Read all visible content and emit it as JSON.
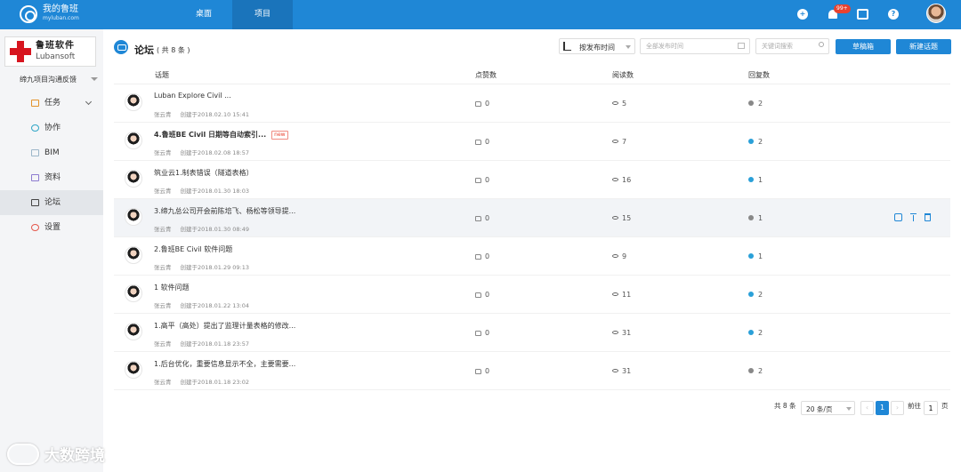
{
  "topbar": {
    "app_title": "我的鲁班",
    "app_sub": "myluban.com",
    "tabs": [
      {
        "label": "桌面"
      },
      {
        "label": "项目"
      }
    ],
    "badge": "99+",
    "icons": [
      "plus-icon",
      "bell-icon",
      "calendar-icon",
      "help-icon",
      "avatar"
    ],
    "accent": "#1f87d6"
  },
  "sidebar": {
    "brand_cn": "鲁班软件",
    "brand_en": "Lubansoft",
    "project": "缔九项目沟通反馈",
    "items": [
      {
        "label": "任务",
        "icon": "task-icon"
      },
      {
        "label": "协作",
        "icon": "collab-icon"
      },
      {
        "label": "BIM",
        "icon": "bim-icon"
      },
      {
        "label": "资料",
        "icon": "data-icon"
      },
      {
        "label": "论坛",
        "icon": "forum-icon"
      },
      {
        "label": "设置",
        "icon": "settings-icon"
      }
    ]
  },
  "header": {
    "title": "论坛",
    "count": "( 共 8 条 )",
    "sort_label": "按发布时间",
    "date_placeholder": "全部发布时间",
    "keyword_placeholder": "关键词搜索",
    "draft_button": "草稿箱",
    "new_button": "新建话题"
  },
  "table": {
    "columns": [
      "话题",
      "点赞数",
      "阅读数",
      "回复数"
    ],
    "rows": [
      {
        "title": "Luban Explore Civil ...",
        "author": "张云青",
        "date": "创建于2018.02.10 15:41",
        "likes": "0",
        "reads": "5",
        "replies": "2",
        "dot": "#888888"
      },
      {
        "title": "4.鲁班BE Civil 日期等自动索引...",
        "bold": true,
        "tag": "new",
        "author": "张云青",
        "date": "创建于2018.02.08 18:57",
        "likes": "0",
        "reads": "7",
        "replies": "2",
        "dot": "#2aa0d8"
      },
      {
        "title": "筑业云1.制表错误（隧道表格）",
        "author": "张云青",
        "date": "创建于2018.01.30 18:03",
        "likes": "0",
        "reads": "16",
        "replies": "1",
        "dot": "#2aa0d8"
      },
      {
        "title": "3.缔九总公司开会前陈培飞、杨松等领导提...",
        "author": "张云青",
        "date": "创建于2018.01.30 08:49",
        "likes": "0",
        "reads": "15",
        "replies": "1",
        "dot": "#888888"
      },
      {
        "title": "2.鲁班BE Civil 软件问题",
        "author": "张云青",
        "date": "创建于2018.01.29 09:13",
        "likes": "0",
        "reads": "9",
        "replies": "1",
        "dot": "#2aa0d8"
      },
      {
        "title": "1 软件问题",
        "author": "张云青",
        "date": "创建于2018.01.22 13:04",
        "likes": "0",
        "reads": "11",
        "replies": "2",
        "dot": "#2aa0d8"
      },
      {
        "title": "1.高平（高处）提出了监理计量表格的修改...",
        "author": "张云青",
        "date": "创建于2018.01.18 23:57",
        "likes": "0",
        "reads": "31",
        "replies": "2",
        "dot": "#2aa0d8"
      },
      {
        "title": "1.后台优化，重要信息显示不全，主要需要...",
        "author": "张云青",
        "date": "创建于2018.01.18 23:02",
        "likes": "0",
        "reads": "31",
        "replies": "2",
        "dot": "#888888"
      }
    ]
  },
  "pagination": {
    "total": "共 8 条",
    "page_size": "20 条/页",
    "prev": "‹",
    "current": "1",
    "next": "›",
    "goto_label": "前往",
    "goto_value": "1",
    "page_suffix": "页"
  },
  "watermark": "大数跨境"
}
